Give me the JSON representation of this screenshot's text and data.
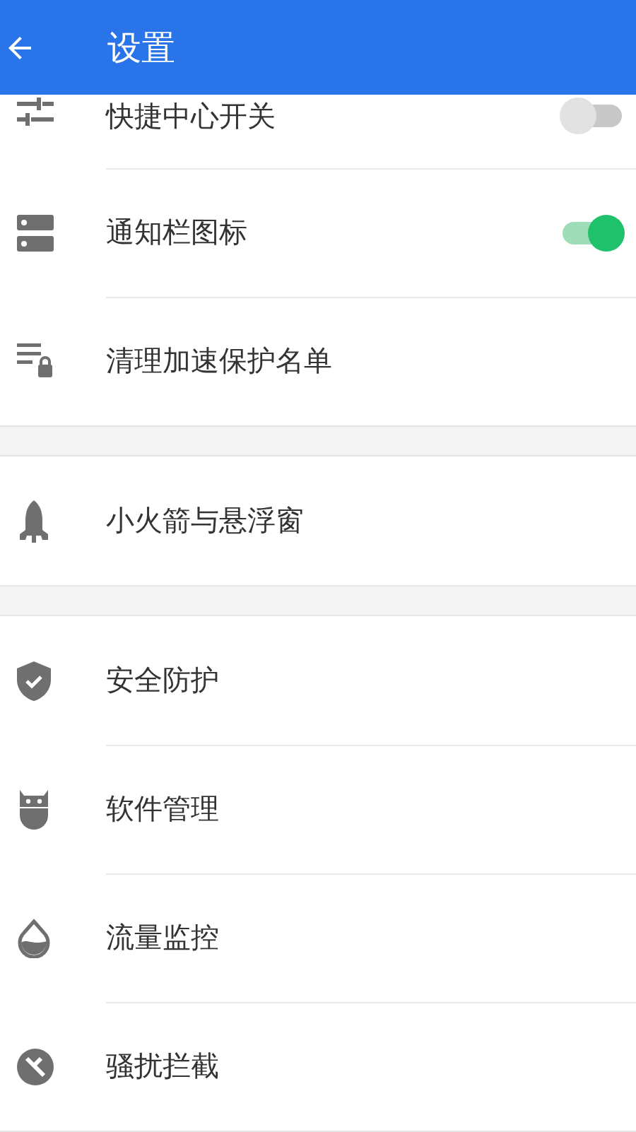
{
  "header": {
    "back_icon": true,
    "title": "设置"
  },
  "groups": [
    {
      "items": [
        {
          "label": "快捷中心开关",
          "kind": "toggle",
          "on": false
        },
        {
          "label": "通知栏图标",
          "kind": "toggle",
          "on": true
        },
        {
          "label": "清理加速保护名单",
          "kind": "link"
        }
      ]
    },
    {
      "items": [
        {
          "label": "小火箭与悬浮窗",
          "kind": "link"
        }
      ]
    },
    {
      "items": [
        {
          "label": "安全防护",
          "kind": "link"
        },
        {
          "label": "软件管理",
          "kind": "link"
        },
        {
          "label": "流量监控",
          "kind": "link"
        },
        {
          "label": "骚扰拦截",
          "kind": "link"
        }
      ]
    }
  ]
}
